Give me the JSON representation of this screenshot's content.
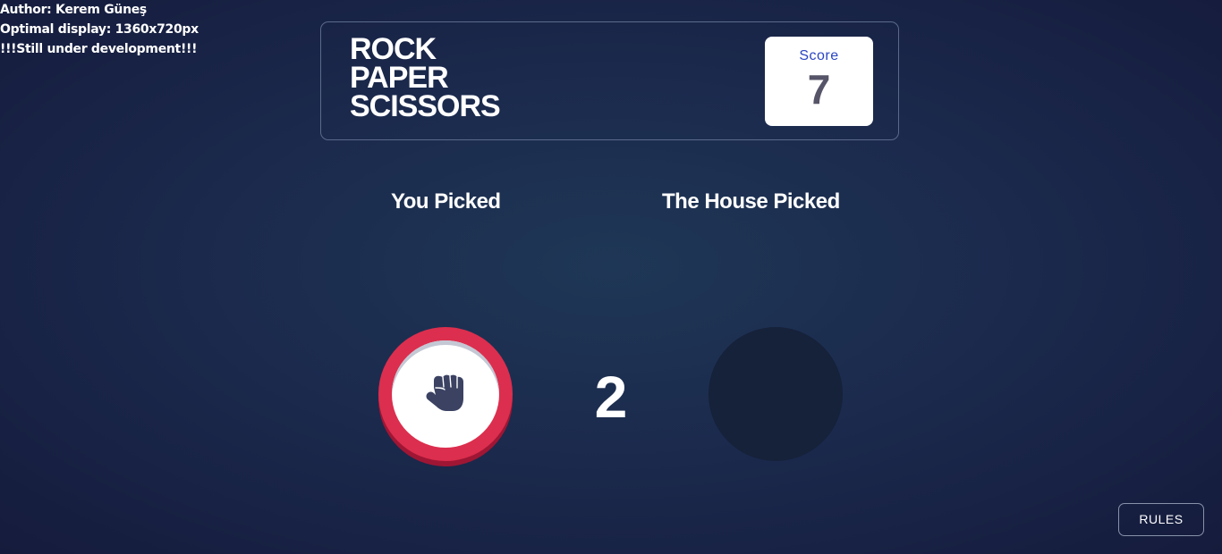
{
  "meta": {
    "author": "Author: Kerem Güneş",
    "optimal_display": "Optimal display: 1360x720px",
    "status": "!!!Still under development!!!"
  },
  "header": {
    "title_lines": [
      "ROCK",
      "PAPER",
      "SCISSORS"
    ],
    "score_label": "Score",
    "score_value": "7"
  },
  "game": {
    "you_picked_label": "You Picked",
    "house_picked_label": "The House Picked",
    "player_choice": "rock",
    "player_choice_icon": "rock-fist-icon",
    "countdown": "2"
  },
  "footer": {
    "rules_label": "RULES"
  },
  "colors": {
    "background_center": "#1f3756",
    "background_edge": "#151b3c",
    "header_border": "#5b6a8a",
    "score_label": "#2a45c2",
    "score_value": "#565468",
    "rock_ring": "#dc2e4e",
    "rock_ring_shadow": "#9f1634",
    "icon": "#3b4262",
    "house_placeholder": "#16213a"
  }
}
